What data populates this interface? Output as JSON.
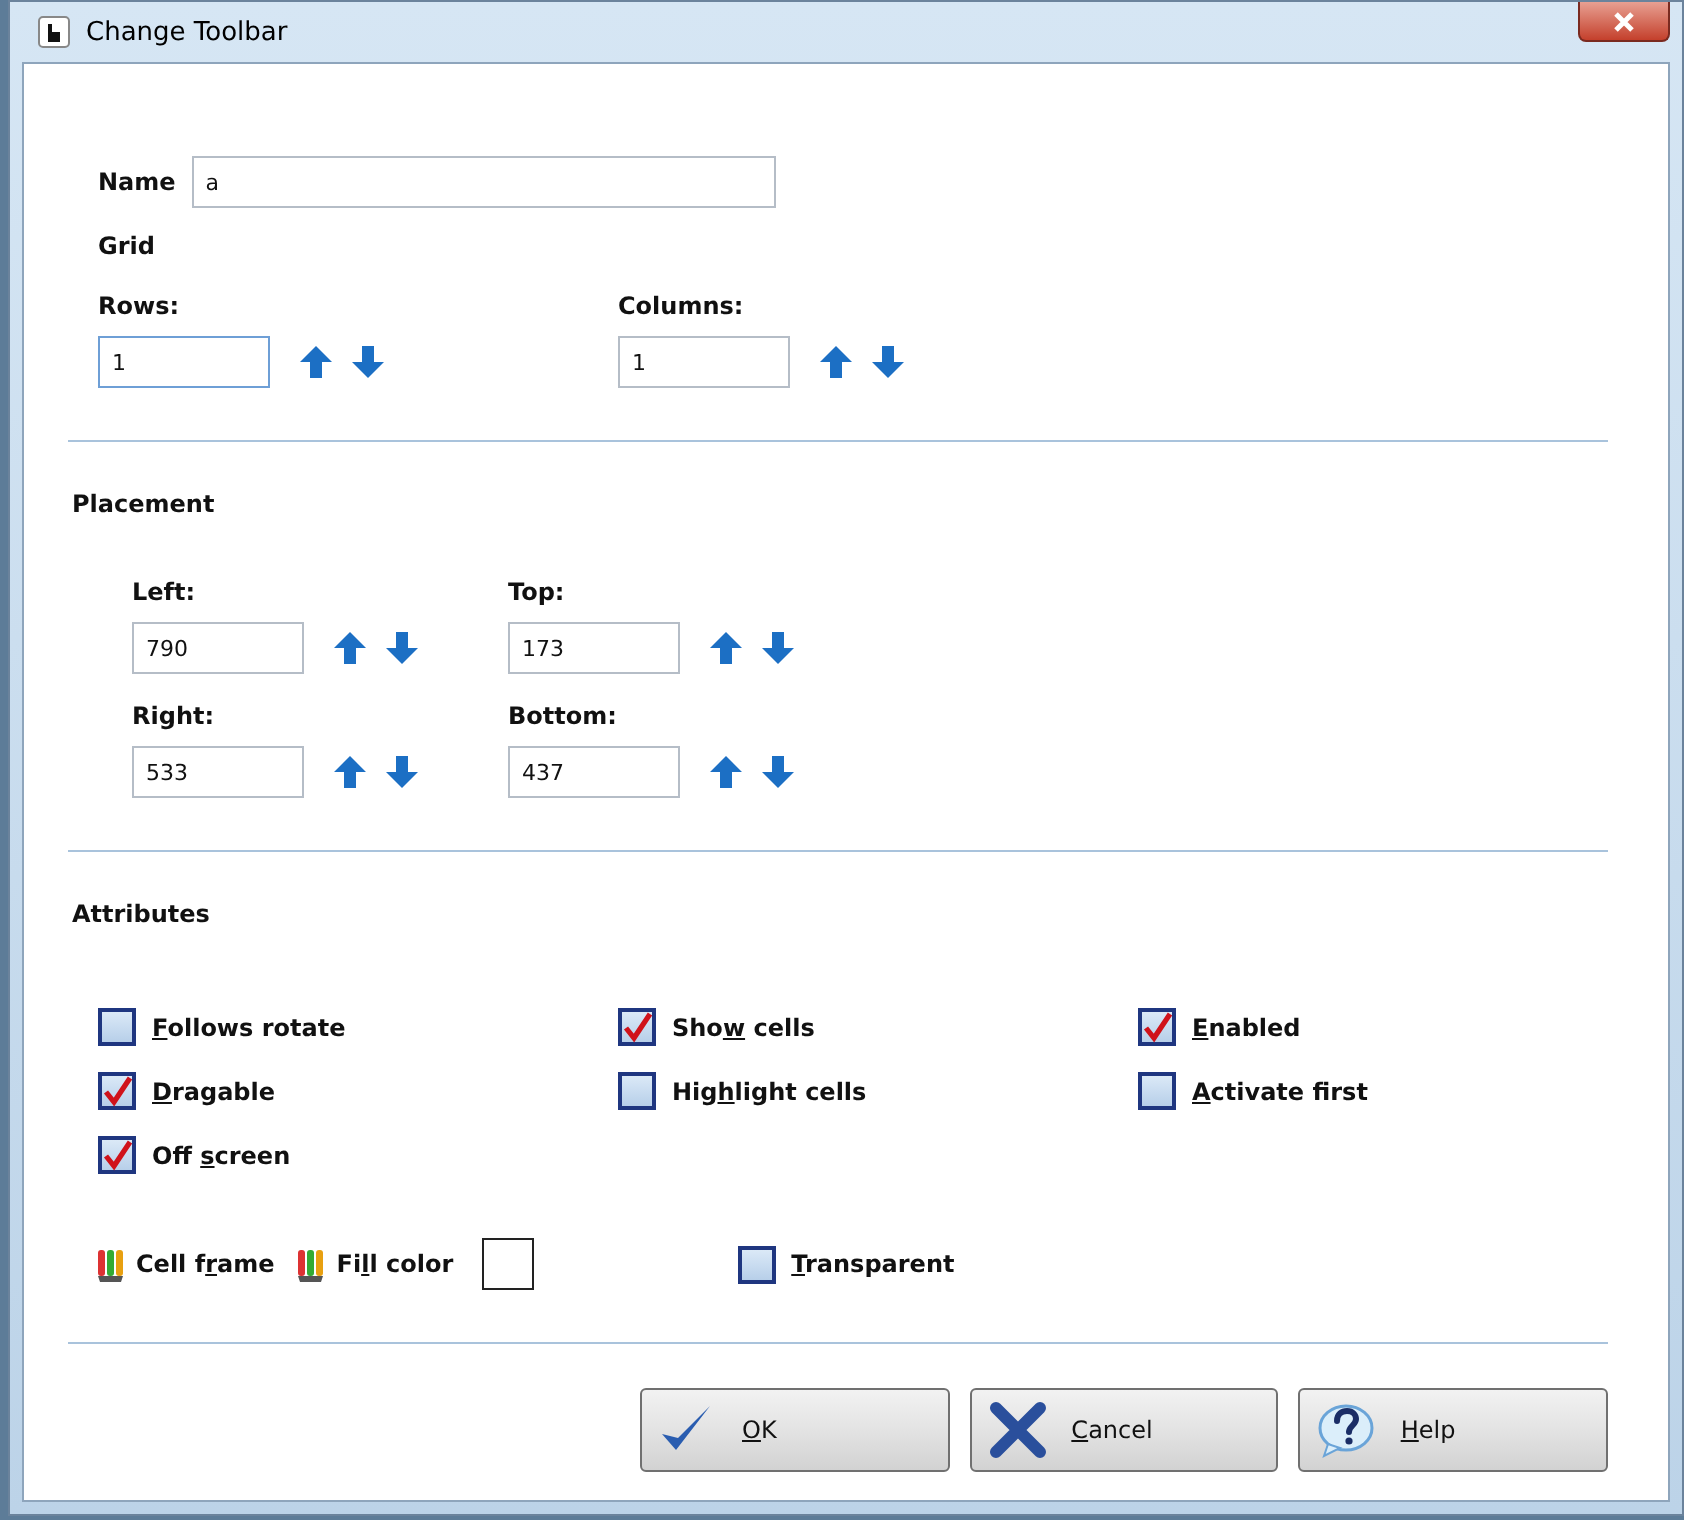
{
  "window": {
    "title": "Change Toolbar"
  },
  "name_field": {
    "label": "Name",
    "value": "a"
  },
  "grid": {
    "title": "Grid",
    "fields": [
      {
        "label": "Rows:",
        "value": "1",
        "focused": true
      },
      {
        "label": "Columns:",
        "value": "1",
        "focused": false
      }
    ]
  },
  "placement": {
    "title": "Placement",
    "fields": [
      {
        "label": "Left:",
        "value": "790"
      },
      {
        "label": "Top:",
        "value": "173"
      },
      {
        "label": "Right:",
        "value": "533"
      },
      {
        "label": "Bottom:",
        "value": "437"
      }
    ]
  },
  "attributes": {
    "title": "Attributes",
    "checkboxes": [
      {
        "label": {
          "key": "F",
          "post": "ollows rotate"
        },
        "checked": false
      },
      {
        "label": {
          "pre": "Sho",
          "key": "w",
          "post": " cells"
        },
        "checked": true
      },
      {
        "label": {
          "key": "E",
          "post": "nabled"
        },
        "checked": true
      },
      {
        "label": {
          "key": "D",
          "post": "ragable"
        },
        "checked": true
      },
      {
        "label": {
          "pre": "Hig",
          "key": "h",
          "post": "light cells"
        },
        "checked": false
      },
      {
        "label": {
          "key": "A",
          "post": "ctivate first"
        },
        "checked": false
      },
      {
        "label": {
          "pre": "Off ",
          "key": "s",
          "post": "creen"
        },
        "checked": true
      }
    ],
    "cell_frame": {
      "label": {
        "pre": "Cell f",
        "key": "r",
        "post": "ame"
      }
    },
    "fill_color": {
      "label": {
        "pre": "Fi",
        "key": "l",
        "post": "l color"
      },
      "color": "#ffffff"
    },
    "transparent": {
      "label": {
        "key": "T",
        "post": "ransparent"
      },
      "checked": false
    }
  },
  "buttons": [
    {
      "kind": "ok",
      "label": {
        "key": "O",
        "post": "K"
      }
    },
    {
      "kind": "cancel",
      "label": {
        "key": "C",
        "post": "ancel"
      }
    },
    {
      "kind": "help",
      "label": {
        "key": "H",
        "post": "elp"
      }
    }
  ]
}
